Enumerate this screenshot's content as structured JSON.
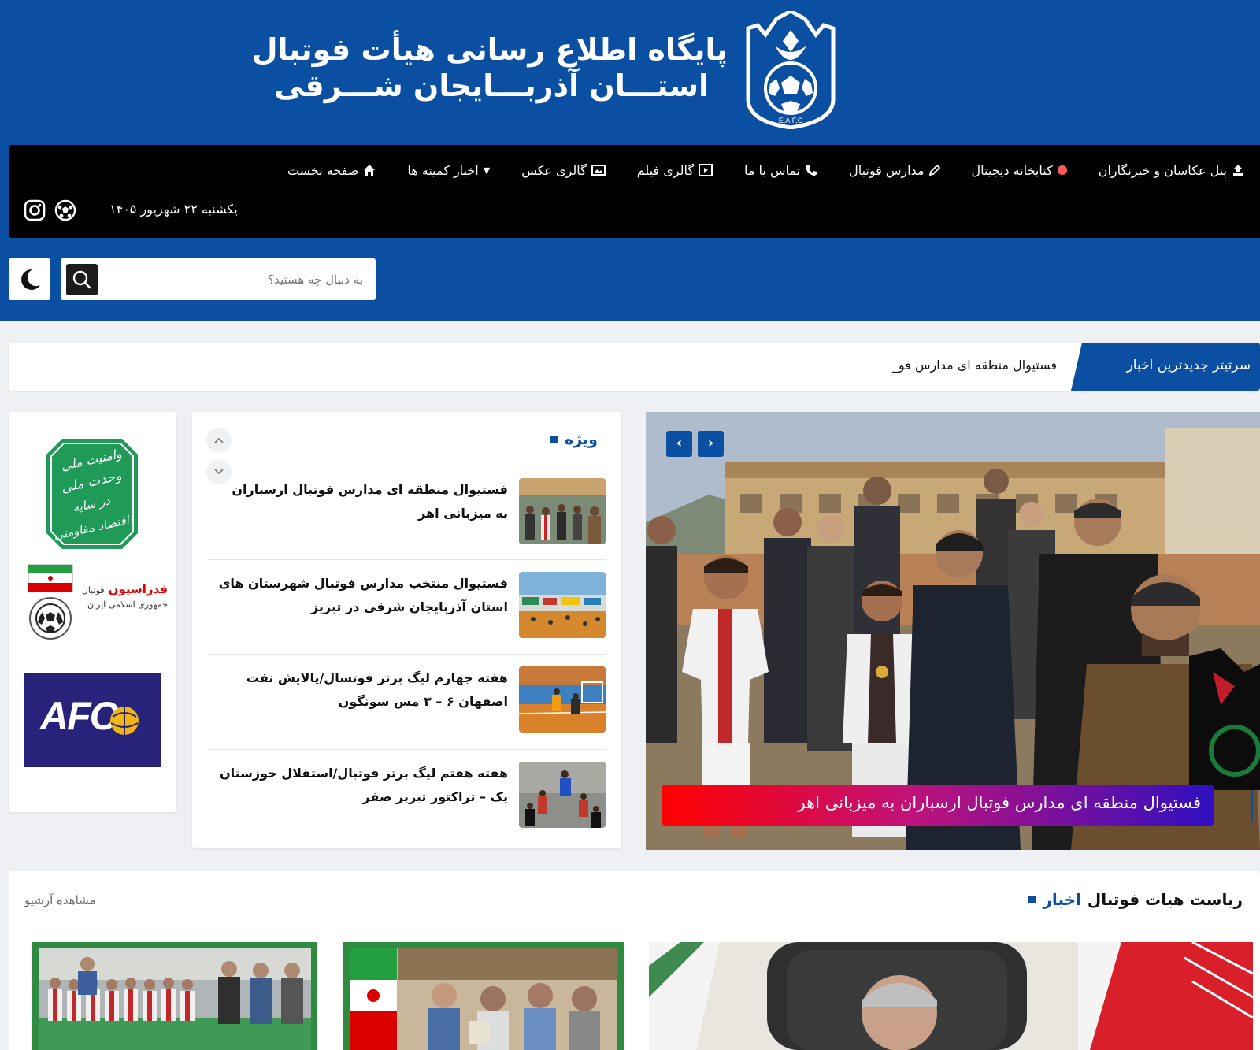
{
  "header": {
    "logo_title_line1": "پایگاه اطلاع رسانی هیأت فوتبال",
    "logo_title_line2": "استـــان آذربـــایجان شـــرقی",
    "logo_emblem_text": "E.A.F.C"
  },
  "nav": {
    "items": [
      {
        "label": "صفحه نخست",
        "icon": "home-icon"
      },
      {
        "label": "اخبار کمیته ها",
        "icon": "caret-down-icon"
      },
      {
        "label": "گالری عکس",
        "icon": "photo-gallery-icon"
      },
      {
        "label": "گالری فیلم",
        "icon": "video-gallery-icon"
      },
      {
        "label": "تماس با ما",
        "icon": "phone-icon"
      },
      {
        "label": "مدارس فوتبال",
        "icon": "pencil-icon"
      },
      {
        "label": "کتابخانه دیجیتال",
        "icon": "dot-icon"
      },
      {
        "label": "پنل عکاسان و خبرنگاران",
        "icon": "upload-icon"
      }
    ],
    "date": "یکشنبه ۲۲ شهریور ۱۴۰۵",
    "social": [
      "football-icon",
      "instagram-icon"
    ]
  },
  "search": {
    "placeholder": "به دنبال چه هستید؟",
    "button_icon": "search-icon",
    "dark_mode_icon": "moon-icon"
  },
  "ticker": {
    "label": "سرتیتر جدیدترین اخبار",
    "text": "فستیوال منطقه ای مدارس فو_"
  },
  "featured": {
    "title": "ویژه",
    "items": [
      {
        "title": "فستیوال منطقه ای مدارس فوتبال ارسباران به میزبانی اهر"
      },
      {
        "title": "فستیوال منتخب مدارس فوتبال شهرستان های استان آذربایجان شرقی در تبریز"
      },
      {
        "title": "هفته چهارم لیگ برتر فوتسال/پالایش نفت اصفهان ۶ – ۳ مس سونگون"
      },
      {
        "title": "هفته هفتم لیگ برتر فوتبال/استقلال خوزستان یک – تراکتور تبریز صفر"
      }
    ]
  },
  "slider": {
    "caption": "فستیوال منطقه ای مدارس فوتبال ارسباران به میزبانی اهر",
    "prev_label": "‹",
    "next_label": "›"
  },
  "ads": {
    "slogan": [
      "وحدت ملی",
      "وامنیت ملی",
      "اقتصاد مقاومتی",
      "در سایه"
    ],
    "ffiri_red": "فدراسیون",
    "ffiri_word": "فوتبال",
    "ffiri_sub": "جمهوری اسلامی ایران",
    "afc": "AFC"
  },
  "presidency": {
    "title_prefix": "اخبار",
    "title_rest": "ریاست هیات فوتبال",
    "archive": "مشاهده آرشیو"
  },
  "colors": {
    "brand_blue": "#0b4fa3",
    "nav_black": "#000000",
    "caption_gradient": [
      "#ff0000",
      "#c0127a",
      "#2f0fc0"
    ]
  }
}
